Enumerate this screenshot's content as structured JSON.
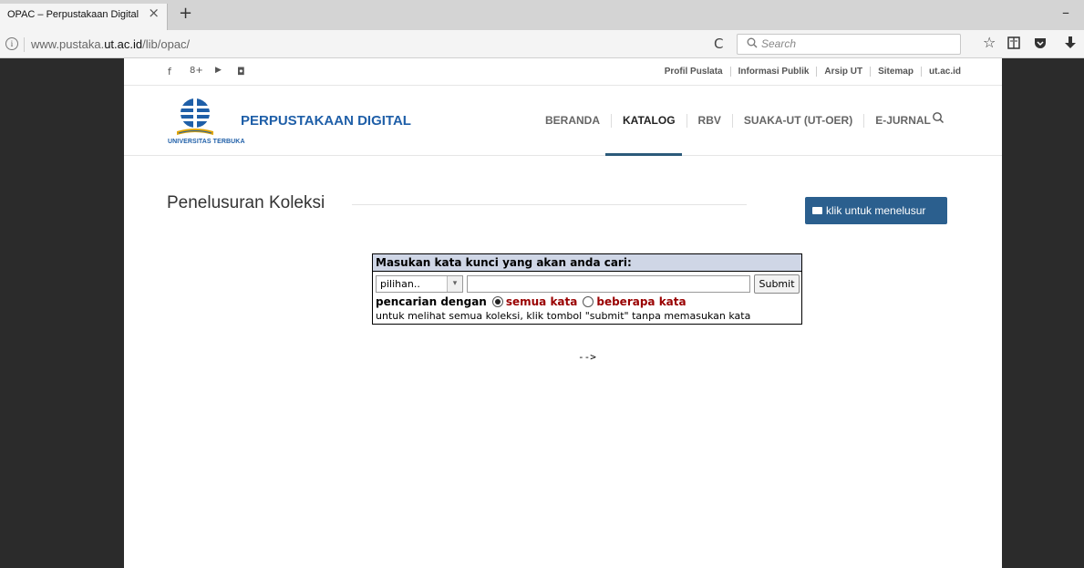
{
  "browser": {
    "tab_title": "OPAC – Perpustakaan Digital",
    "tab_close": "×",
    "new_tab": "+",
    "minimize": "–",
    "url_host_pre": "www.pustaka.",
    "url_host_bold": "ut.ac.id",
    "url_path": "/lib/opac/",
    "reload": "C",
    "search_placeholder": "Search"
  },
  "topbar": {
    "social": [
      "f",
      "8+",
      "▶",
      "◘"
    ],
    "links": [
      "Profil Puslata",
      "Informasi Publik",
      "Arsip UT",
      "Sitemap",
      "ut.ac.id"
    ]
  },
  "header": {
    "logo_text": "UNIVERSITAS TERBUKA",
    "site_title": "PERPUSTAKAAN DIGITAL",
    "nav": [
      "BERANDA",
      "KATALOG",
      "RBV",
      "SUAKA-UT (UT-OER)",
      "E-JURNAL"
    ],
    "active_nav": "KATALOG",
    "brand_color": "#1f5fa8"
  },
  "main": {
    "section_title": "Penelusuran Koleksi",
    "browse_button": "klik untuk menelusur",
    "form": {
      "header": "Masukan kata kunci yang akan anda cari:",
      "select_value": "pilihan..",
      "keyword_value": "",
      "submit_label": "Submit",
      "search_mode_label": "pencarian dengan",
      "option_all": "semua kata",
      "option_some": "beberapa kata",
      "selected_option": "semua kata",
      "hint": "untuk melihat semua koleksi, klik tombol \"submit\" tanpa memasukan kata"
    },
    "stray_text": "-->"
  }
}
